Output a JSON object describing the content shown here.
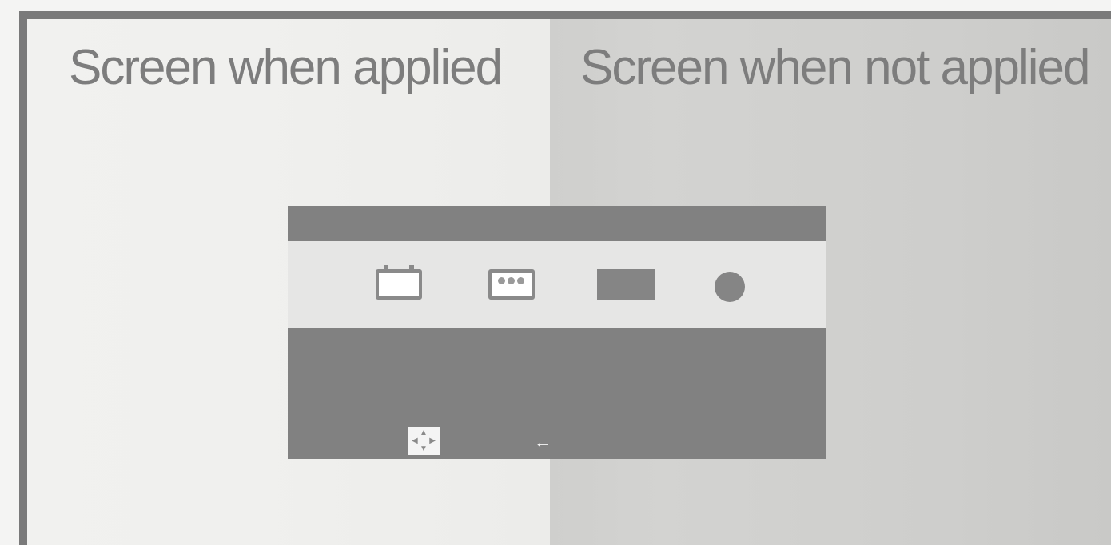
{
  "comparison": {
    "left_caption": "Screen when applied",
    "right_caption": "Screen when not applied"
  },
  "osd_menu": {
    "menu_icons": [
      "picture-icon",
      "color-icon",
      "tracking-icon",
      "setup-icon"
    ],
    "bottom_controls": [
      "select-icon",
      "exit-arrow-icon"
    ]
  },
  "colors": {
    "menu_gray": "#818181",
    "icon_bar": "#e6e6e5",
    "applied_background": "#f0f0ee",
    "not_applied_background": "#d0d0ce",
    "frame": "#7a7a7a"
  }
}
